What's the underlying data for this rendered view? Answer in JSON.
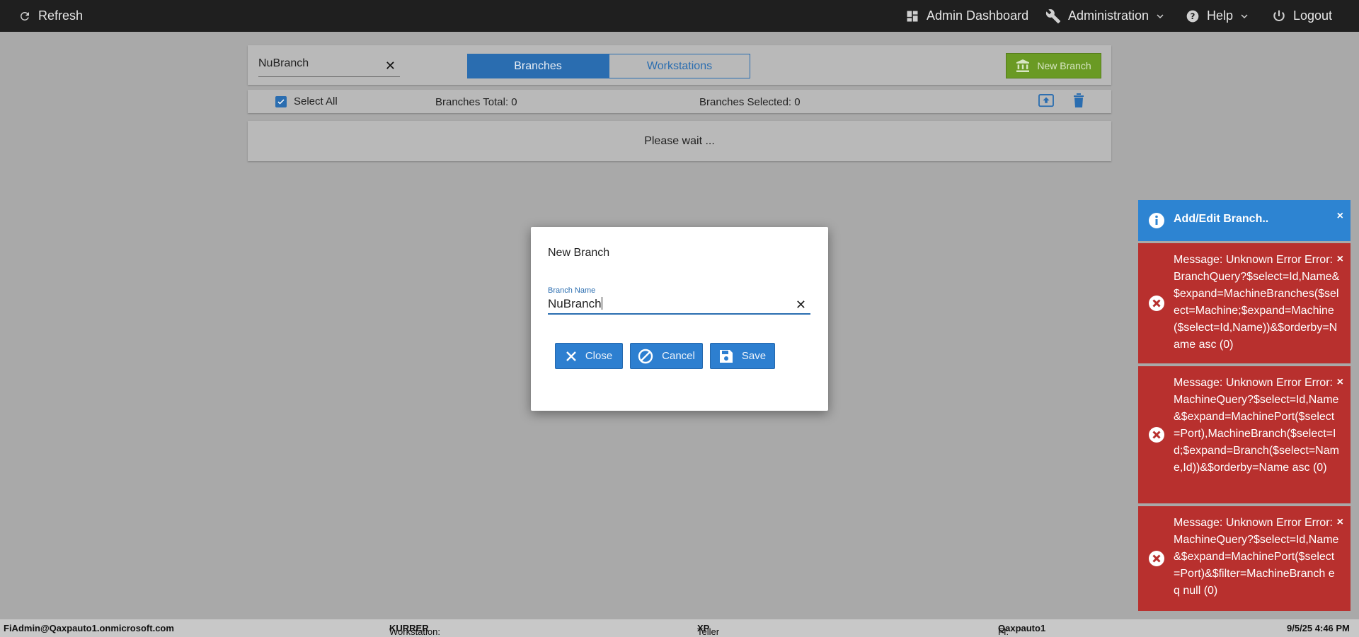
{
  "nav": {
    "refresh": "Refresh",
    "admin_dashboard": "Admin Dashboard",
    "administration": "Administration",
    "help": "Help",
    "logout": "Logout"
  },
  "header": {
    "search_value": "NuBranch",
    "tabs": [
      {
        "label": "Branches",
        "active": true
      },
      {
        "label": "Workstations",
        "active": false
      }
    ],
    "new_branch_label": "New Branch"
  },
  "bar": {
    "select_all_label": "Select All",
    "branches_total": "Branches Total: 0",
    "branches_selected": "Branches Selected: 0"
  },
  "wait_text": "Please wait ...",
  "modal": {
    "title": "New Branch",
    "field_label": "Branch Name",
    "field_value": "NuBranch",
    "close_label": "Close",
    "cancel_label": "Cancel",
    "save_label": "Save"
  },
  "toasts": {
    "info": "Add/Edit Branch..",
    "errors": [
      "Message: Unknown Error Error: BranchQuery?$select=Id,Name&$expand=MachineBranches($select=Machine;$expand=Machine($select=Id,Name))&$orderby=Name asc (0)",
      "Message: Unknown Error Error: MachineQuery?$select=Id,Name&$expand=MachinePort($select=Port),MachineBranch($select=Id;$expand=Branch($select=Name,Id))&$orderby=Name asc (0)",
      "Message: Unknown Error Error: MachineQuery?$select=Id,Name&$expand=MachinePort($select=Port)&$filter=MachineBranch eq null (0)"
    ],
    "close_glyph": "×"
  },
  "footer": {
    "user": "FiAdmin@Qaxpauto1.onmicrosoft.com",
    "workstation_label": "Workstation:",
    "workstation_value": "KURRER",
    "platform_label": "Teller Platform:",
    "platform_value": "XP",
    "fi_label": "FI:",
    "fi_value": "Qaxpauto1",
    "datetime": "9/5/25 4:46 PM"
  },
  "colors": {
    "accent": "#2d7fd0",
    "success": "#6a9a24",
    "error": "#b8302e",
    "info": "#2d84d2"
  }
}
